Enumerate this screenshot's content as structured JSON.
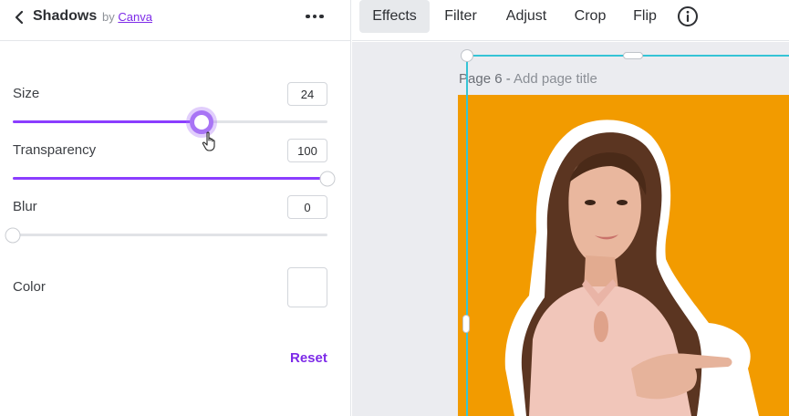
{
  "panel": {
    "title": "Shadows",
    "by_prefix": "by",
    "by_link": "Canva",
    "controls": {
      "size": {
        "label": "Size",
        "value": "24",
        "fill_percent": 60
      },
      "transparency": {
        "label": "Transparency",
        "value": "100",
        "fill_percent": 100
      },
      "blur": {
        "label": "Blur",
        "value": "0",
        "fill_percent": 0
      },
      "color": {
        "label": "Color"
      }
    },
    "reset_label": "Reset"
  },
  "toolbar": {
    "items": [
      {
        "label": "Effects",
        "active": true
      },
      {
        "label": "Filter",
        "active": false
      },
      {
        "label": "Adjust",
        "active": false
      },
      {
        "label": "Crop",
        "active": false
      },
      {
        "label": "Flip",
        "active": false
      }
    ]
  },
  "canvas": {
    "page_label": "Page 6 - ",
    "page_title_placeholder": "Add page title",
    "background_color": "#f29b00"
  },
  "icons": {
    "back": "chevron-left-icon",
    "more": "more-horizontal-icon",
    "info": "info-icon",
    "cursor": "hand-pointer-icon"
  },
  "colors": {
    "accent": "#8b3dff",
    "link": "#7d2ae8",
    "selection": "#35c4d6"
  }
}
